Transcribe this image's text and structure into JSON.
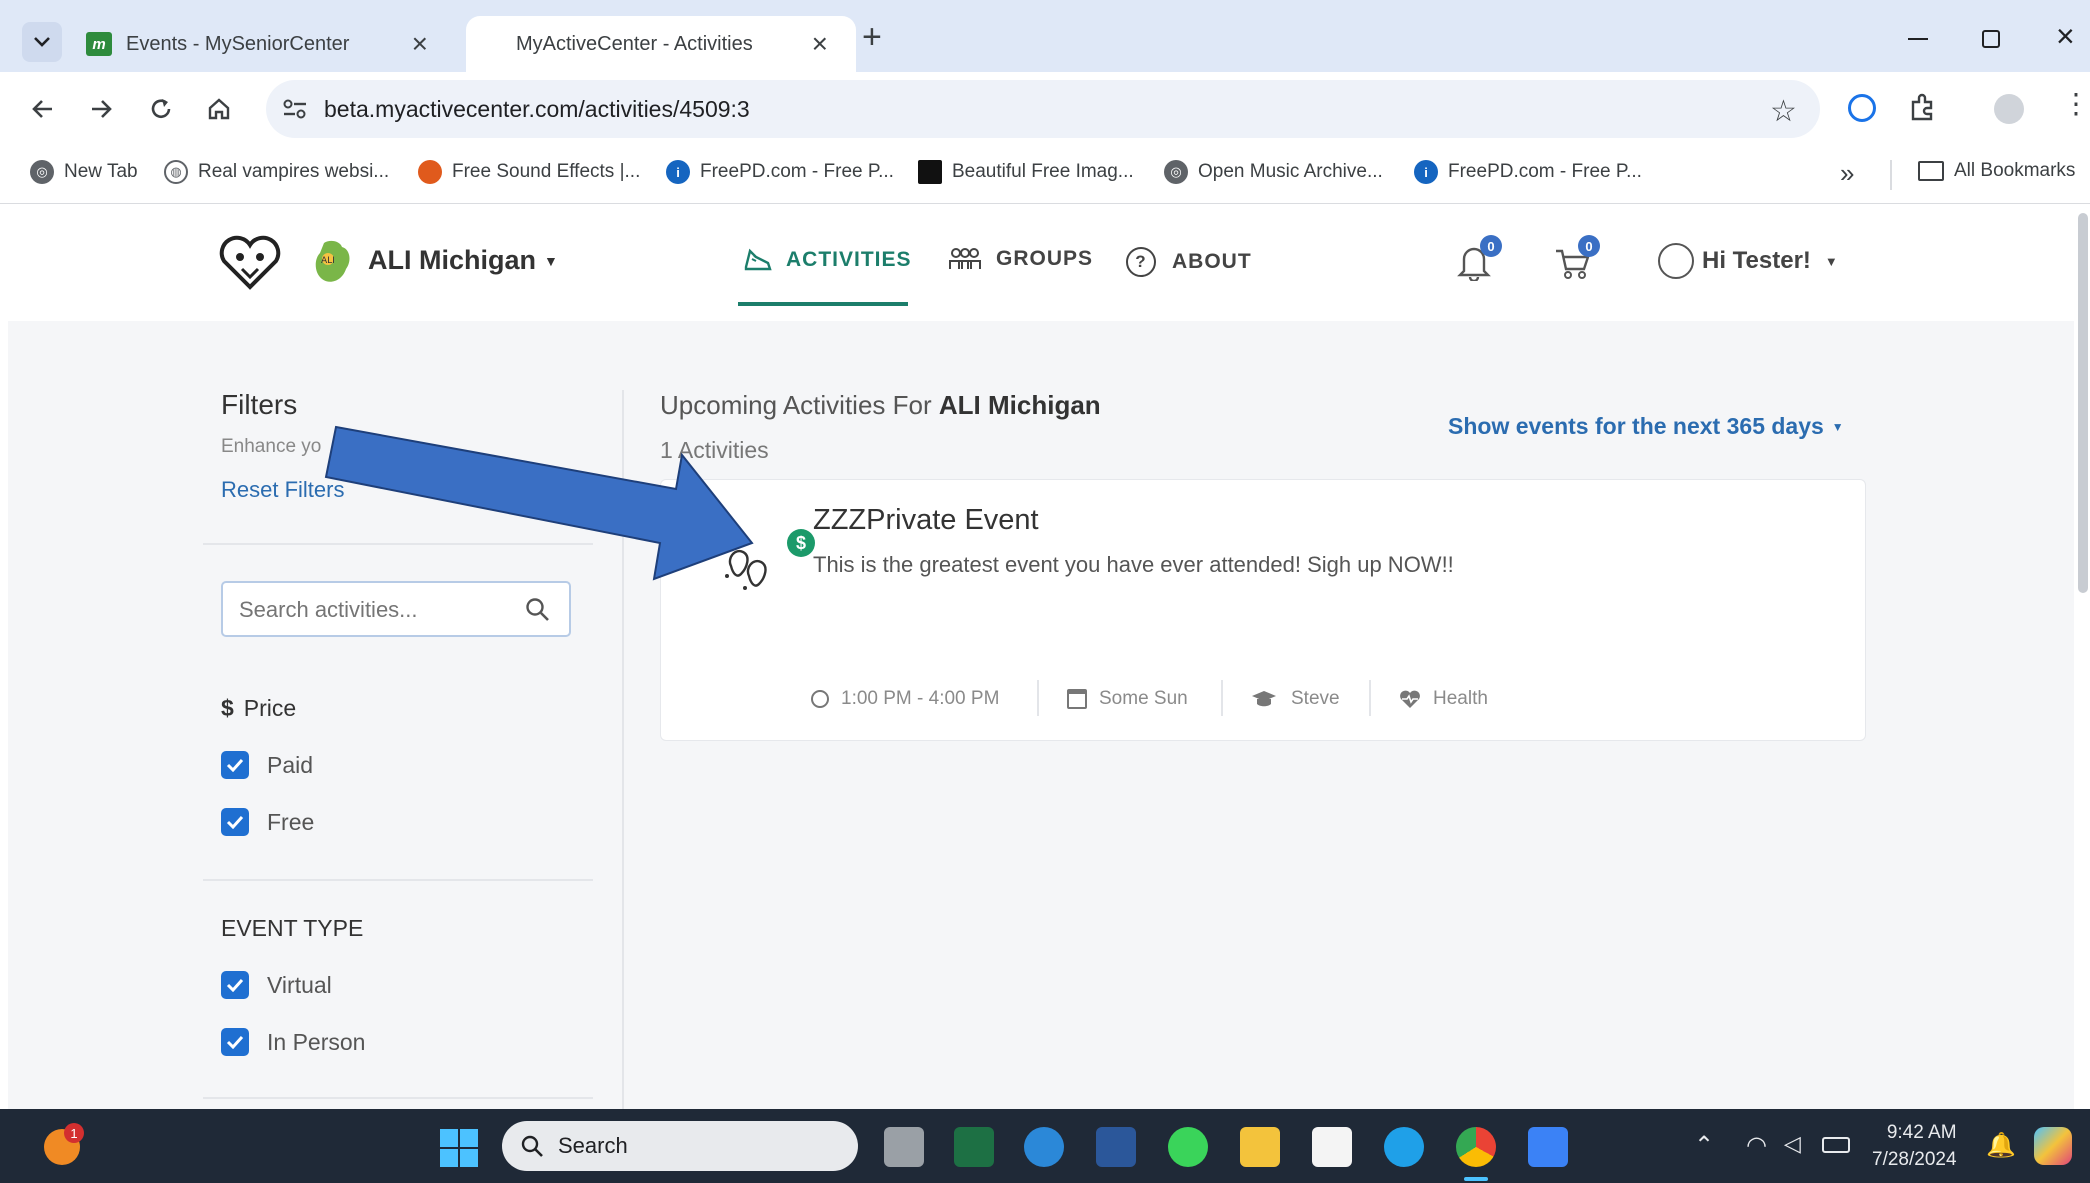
{
  "browser": {
    "tabs": [
      {
        "title": "Events - MySeniorCenter",
        "favicon_text": "m"
      },
      {
        "title": "MyActiveCenter - Activities"
      }
    ],
    "url": "beta.myactivecenter.com/activities/4509:3",
    "bookmarks": [
      {
        "label": "New Tab",
        "icon": "globe-icon"
      },
      {
        "label": "Real vampires websi...",
        "icon": "site-icon"
      },
      {
        "label": "Free Sound Effects |...",
        "icon": "sound-icon"
      },
      {
        "label": "FreePD.com - Free P...",
        "icon": "freepd-icon"
      },
      {
        "label": "Beautiful Free Imag...",
        "icon": "unsplash-icon"
      },
      {
        "label": "Open Music Archive...",
        "icon": "globe-icon"
      },
      {
        "label": "FreePD.com - Free P...",
        "icon": "freepd-icon"
      }
    ],
    "all_bookmarks": "All Bookmarks"
  },
  "app": {
    "org_name": "ALI Michigan",
    "nav": {
      "activities": "ACTIVITIES",
      "groups": "GROUPS",
      "about": "ABOUT"
    },
    "notifications_count": "0",
    "cart_count": "0",
    "greeting": "Hi Tester!"
  },
  "filters": {
    "title": "Filters",
    "subtitle": "Enhance yo",
    "reset": "Reset Filters",
    "search_placeholder": "Search activities...",
    "price_label": "Price",
    "price_symbol": "$",
    "price_options": [
      {
        "label": "Paid",
        "checked": true
      },
      {
        "label": "Free",
        "checked": true
      }
    ],
    "event_type_label": "EVENT TYPE",
    "event_type_options": [
      {
        "label": "Virtual",
        "checked": true
      },
      {
        "label": "In Person",
        "checked": true
      }
    ]
  },
  "main": {
    "heading_prefix": "Upcoming Activities For",
    "heading_org": "ALI Michigan",
    "count": "1 Activities",
    "range_button": "Show events for the next 365 days",
    "events": [
      {
        "title": "ZZZPrivate Event",
        "description": "This is the greatest event you have ever attended! Sigh up NOW!!",
        "time": "1:00 PM - 4:00 PM",
        "days": "Some Sun",
        "instructor": "Steve",
        "category": "Health",
        "price_badge": "$"
      }
    ]
  },
  "taskbar": {
    "search": "Search",
    "time": "9:42 AM",
    "date": "7/28/2024",
    "notification_badge": "1"
  },
  "colors": {
    "accent": "#1c7e6b",
    "link": "#2b6cb0",
    "checkbox": "#1f6fd1",
    "arrow": "#3a6fc4"
  }
}
